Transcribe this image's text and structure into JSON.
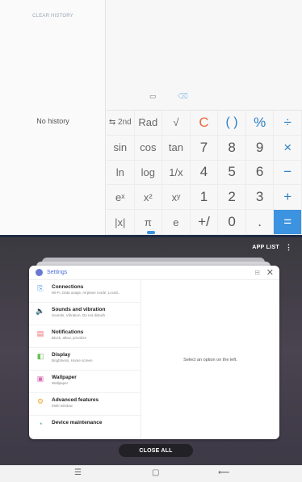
{
  "calculator": {
    "clear_history": "CLEAR HISTORY",
    "no_history": "No history",
    "tools": {
      "ruler": "▭",
      "backspace": "⌫"
    },
    "keys": [
      [
        "⇆ 2nd",
        "Rad",
        "√",
        "C",
        "( )",
        "%",
        "÷"
      ],
      [
        "sin",
        "cos",
        "tan",
        "7",
        "8",
        "9",
        "×"
      ],
      [
        "ln",
        "log",
        "1/x",
        "4",
        "5",
        "6",
        "−"
      ],
      [
        "eˣ",
        "x²",
        "xʸ",
        "1",
        "2",
        "3",
        "+"
      ],
      [
        "|x|",
        "π",
        "e",
        "+/",
        "0",
        ".",
        "="
      ]
    ]
  },
  "recents": {
    "app_list_label": "APP LIST",
    "menu_glyph": "⋮",
    "close_all_label": "CLOSE ALL",
    "card": {
      "app_title": "Settings",
      "multi_window_glyph": "⊟",
      "close_glyph": "✕",
      "items": [
        {
          "title": "Connections",
          "subtitle": "Wi-Fi, Data usage, Airplane mode, Locati...",
          "icon": "connections-icon",
          "glyph": "⎘",
          "color": "#4a90e2"
        },
        {
          "title": "Sounds and vibration",
          "subtitle": "Sounds, Vibration, Do not disturb",
          "icon": "sound-icon",
          "glyph": "🔈",
          "color": "#7b6bd6"
        },
        {
          "title": "Notifications",
          "subtitle": "Block, allow, prioritize",
          "icon": "notifications-icon",
          "glyph": "▤",
          "color": "#f06a6a"
        },
        {
          "title": "Display",
          "subtitle": "Brightness, Home screen",
          "icon": "display-icon",
          "glyph": "◧",
          "color": "#6bbf59"
        },
        {
          "title": "Wallpaper",
          "subtitle": "Wallpaper",
          "icon": "wallpaper-icon",
          "glyph": "▣",
          "color": "#d66fb0"
        },
        {
          "title": "Advanced features",
          "subtitle": "Multi window",
          "icon": "advanced-features-icon",
          "glyph": "⚙",
          "color": "#f0a93b"
        },
        {
          "title": "Device maintenance",
          "subtitle": "",
          "icon": "device-maintenance-icon",
          "glyph": "◔",
          "color": "#4fb3a8"
        }
      ],
      "detail_text": "Select an option on the ",
      "detail_text_end": "left."
    }
  },
  "navbar": {
    "recents_glyph": "☰",
    "home_glyph": "▢",
    "back_glyph": "⟵"
  },
  "colors": {
    "accent": "#3c93e0",
    "clear": "#ec6a3c",
    "operator": "#2b7ec6"
  }
}
